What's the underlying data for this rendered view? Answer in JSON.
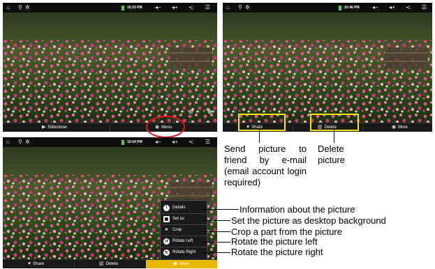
{
  "status_times": {
    "shot1": "10:33 PM",
    "shot2": "10:46 PM",
    "shot3": "10:54 PM"
  },
  "shot1_bar": {
    "slideshow_label": "Slideshow",
    "menu_label": "Menu"
  },
  "shot2_bar": {
    "share_label": "Share",
    "delete_label": "Delete",
    "more_label": "More"
  },
  "shot3_bar": {
    "share_label": "Share",
    "delete_label": "Delete",
    "more_label": "More"
  },
  "more_menu": {
    "items": [
      {
        "label": "Details",
        "icon": "info-icon"
      },
      {
        "label": "Set as",
        "icon": "set-as-icon"
      },
      {
        "label": "Crop",
        "icon": "crop-icon"
      },
      {
        "label": "Rotate Left",
        "icon": "rotate-left-icon"
      },
      {
        "label": "Rotate Right",
        "icon": "rotate-right-icon"
      }
    ]
  },
  "captions": {
    "share_desc": "Send picture to friend by e-mail (email account login required)",
    "delete_desc": "Delete picture"
  },
  "callouts": {
    "details": "Information about the picture",
    "set_as": "Set the picture as desktop background",
    "crop": "Crop a part from the picture",
    "rotate_left": "Rotate the picture left",
    "rotate_right": "Rotate the picture right"
  },
  "colors": {
    "highlight_circle": "#e0141a",
    "highlight_box": "#f0e800",
    "active_more_button": "#e8b800"
  }
}
